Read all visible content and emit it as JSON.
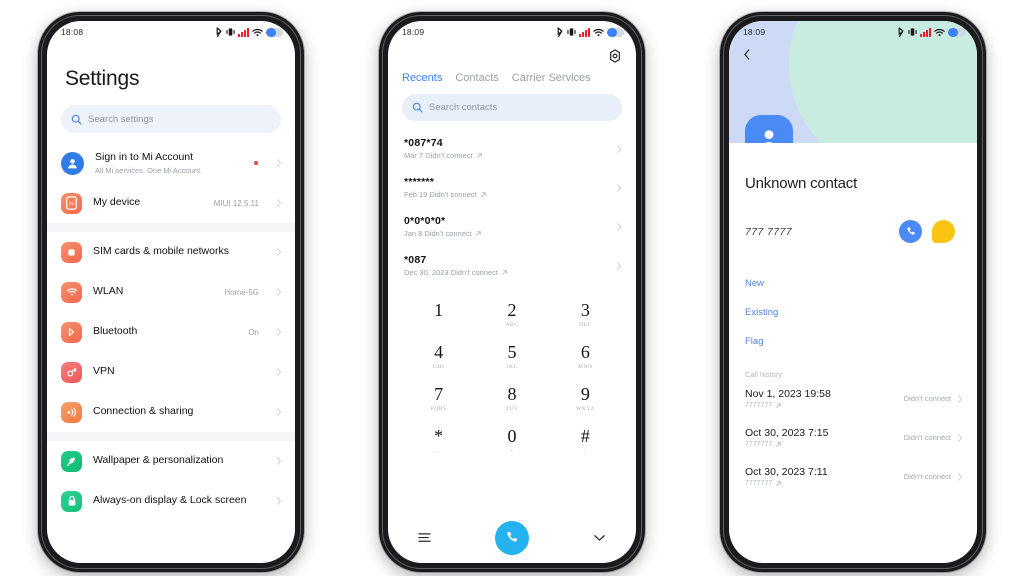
{
  "phones": [
    {
      "id": "settings",
      "status": {
        "time": "18:08",
        "icons": [
          "bluetooth-icon",
          "vibrate-icon",
          "signal-icon",
          "wifi-icon",
          "battery-icon"
        ]
      },
      "title": "Settings",
      "search": {
        "placeholder": "Search settings",
        "value": ""
      },
      "account": {
        "label": "Sign in to Mi Account",
        "sublabel": "All Mi services. One Mi Account.",
        "badge_color": "#e8453c"
      },
      "device": {
        "label": "My device",
        "value": "MIUI 12.5.11",
        "icon_color": "#f0714b"
      },
      "groups": [
        [
          {
            "label": "SIM cards & mobile networks",
            "value": "",
            "icon": "sim-icon",
            "color1": "#fb8f6e",
            "color2": "#f2694a"
          },
          {
            "label": "WLAN",
            "value": "Home-5G",
            "icon": "wifi-icon",
            "color1": "#fb8f6e",
            "color2": "#f2694a"
          },
          {
            "label": "Bluetooth",
            "value": "On",
            "icon": "bluetooth-icon",
            "color1": "#fb8f6e",
            "color2": "#f2694a"
          },
          {
            "label": "VPN",
            "value": "",
            "icon": "vpn-key-icon",
            "color1": "#fb7e7e",
            "color2": "#ee5757"
          },
          {
            "label": "Connection & sharing",
            "value": "",
            "icon": "share-icon",
            "color1": "#fba06e",
            "color2": "#f4783f"
          }
        ],
        [
          {
            "label": "Wallpaper & personalization",
            "value": "",
            "icon": "brush-icon",
            "color1": "#22cc86",
            "color2": "#0fbb72"
          },
          {
            "label": "Always-on display & Lock screen",
            "value": "",
            "icon": "lock-icon",
            "color1": "#2fd291",
            "color2": "#16c07c"
          }
        ]
      ]
    },
    {
      "id": "dialer",
      "status": {
        "time": "18:09",
        "icons": [
          "bluetooth-icon",
          "vibrate-icon",
          "signal-icon",
          "wifi-icon",
          "battery-icon"
        ]
      },
      "settings_icon": "gear-icon",
      "tabs": [
        {
          "label": "Recents",
          "active": true
        },
        {
          "label": "Contacts",
          "active": false
        },
        {
          "label": "Carrier Services",
          "active": false
        }
      ],
      "search": {
        "placeholder": "Search contacts",
        "value": ""
      },
      "calls": [
        {
          "number": "*087*74",
          "detail": "Mar 7 Didn't connect"
        },
        {
          "number": "*******",
          "detail": "Feb 19 Didn't connect"
        },
        {
          "number": "0*0*0*0*",
          "detail": "Jan 8 Didn't connect"
        },
        {
          "number": "*087",
          "detail": "Dec 30, 2023 Didn't connect"
        }
      ],
      "keypad": [
        {
          "digit": "1",
          "letters": ""
        },
        {
          "digit": "2",
          "letters": "ABC"
        },
        {
          "digit": "3",
          "letters": "DEF"
        },
        {
          "digit": "4",
          "letters": "GHI"
        },
        {
          "digit": "5",
          "letters": "JKL"
        },
        {
          "digit": "6",
          "letters": "MNO"
        },
        {
          "digit": "7",
          "letters": "PQRS"
        },
        {
          "digit": "8",
          "letters": "TUV"
        },
        {
          "digit": "9",
          "letters": "WXYZ"
        },
        {
          "digit": "*",
          "letters": ","
        },
        {
          "digit": "0",
          "letters": "+"
        },
        {
          "digit": "#",
          "letters": ";"
        }
      ],
      "dialbar": {
        "menu_icon": "hamburger-icon",
        "call_icon": "phone-icon",
        "collapse_icon": "chevron-down-icon",
        "call_color": "#25b3f0"
      }
    },
    {
      "id": "contact",
      "status": {
        "time": "18:09",
        "icons": [
          "bluetooth-icon",
          "vibrate-icon",
          "signal-icon",
          "wifi-icon",
          "battery-icon"
        ]
      },
      "back_icon": "chevron-left-icon",
      "avatar_icon": "person-icon",
      "name": "Unknown contact",
      "number": "777 7777",
      "actions": [
        {
          "icon": "phone-icon",
          "color": "#4a8af4"
        },
        {
          "icon": "message-icon",
          "color": "#fbc412"
        }
      ],
      "links": [
        "New",
        "Existing",
        "Flag"
      ],
      "history_label": "Call history",
      "history": [
        {
          "date": "Nov 1, 2023 19:58",
          "number": "7777777",
          "status": "Didn't connect"
        },
        {
          "date": "Oct 30, 2023 7:15",
          "number": "7777777",
          "status": "Didn't connect"
        },
        {
          "date": "Oct 30, 2023 7:11",
          "number": "7777777",
          "status": "Didn't connect"
        }
      ]
    }
  ]
}
